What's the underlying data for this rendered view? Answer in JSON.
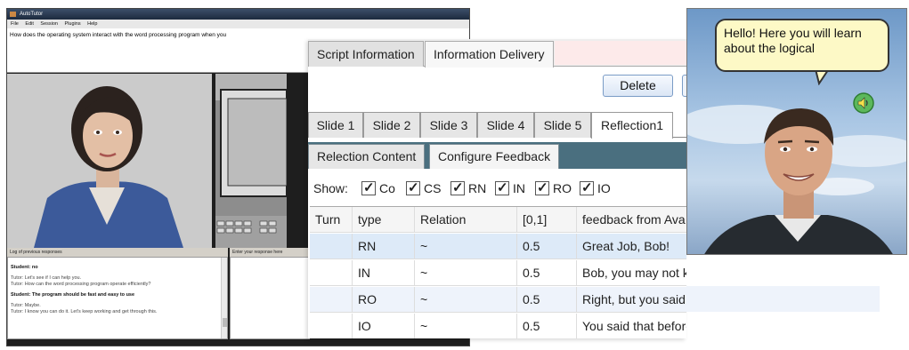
{
  "autotutor": {
    "title": "AutoTutor",
    "menu": [
      "File",
      "Edit",
      "Session",
      "Plugins",
      "Help"
    ],
    "question": "How does the operating system interact with the word processing program when you",
    "log_label": "Log of previous responses",
    "input_label": "Enter your response here",
    "log": [
      {
        "kind": "stu",
        "text": "Student: no"
      },
      {
        "kind": "tut",
        "text": "Tutor: Let's see if I can help you."
      },
      {
        "kind": "tut",
        "text": "Tutor: How can the word processing program operate efficiently?"
      },
      {
        "kind": "stu",
        "text": "Student: The program should be fast and easy to use"
      },
      {
        "kind": "tut",
        "text": "Tutor: Maybe."
      },
      {
        "kind": "tut",
        "text": "Tutor: I know you can do it. Let's keep working and get through this."
      }
    ]
  },
  "authoring": {
    "top_tabs": [
      "Script Information",
      "Information Delivery"
    ],
    "delete_label": "Delete",
    "slide_tabs": [
      "Slide 1",
      "Slide 2",
      "Slide 3",
      "Slide 4",
      "Slide 5",
      "Reflection1"
    ],
    "sub_tabs": [
      "Relection Content",
      "Configure Feedback"
    ],
    "show_label": "Show:",
    "filters": [
      "Co",
      "CS",
      "RN",
      "IN",
      "RO",
      "IO"
    ],
    "columns": [
      "Turn",
      "type",
      "Relation",
      "[0,1]",
      "feedback from Ava"
    ],
    "rows": [
      {
        "turn": "",
        "type": "RN",
        "relation": "~",
        "value": "0.5",
        "feedback": "Great Job, Bob!"
      },
      {
        "turn": "",
        "type": "IN",
        "relation": "~",
        "value": "0.5",
        "feedback": "Bob, you may not know what you are talking about!"
      },
      {
        "turn": "",
        "type": "RO",
        "relation": "~",
        "value": "0.5",
        "feedback": "Right, but you said something similar before."
      },
      {
        "turn": "",
        "type": "IO",
        "relation": "~",
        "value": "0.5",
        "feedback": "You said that before and it was wrong then too!"
      }
    ]
  },
  "agent": {
    "bubble_text": "Hello! Here you will learn about the logical"
  },
  "colors": {
    "selected_row": "#ddeaf8",
    "subtab_bar": "#4a6f7f",
    "bubble": "#fdf9c6",
    "speaker": "#5cb85c"
  },
  "icons": [
    "speaker-icon",
    "checkbox-checked-icon",
    "app-icon"
  ]
}
